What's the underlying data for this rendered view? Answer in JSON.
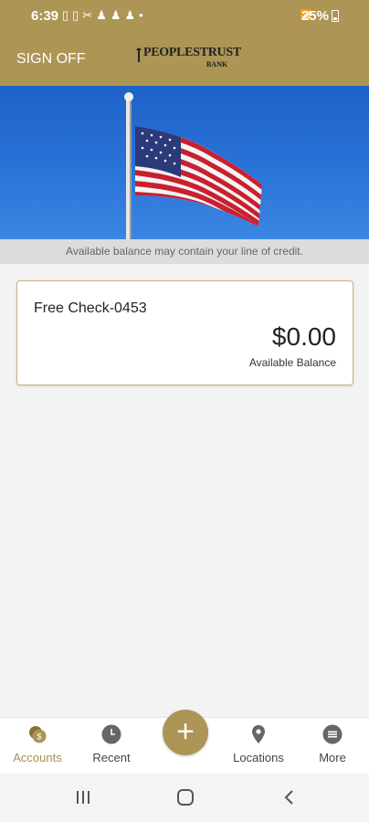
{
  "status_bar": {
    "time": "6:39",
    "battery": "25%",
    "left_icons": [
      "phone-icon",
      "phone-icon",
      "scissors-icon",
      "figure-icon",
      "figure-icon",
      "figure-icon",
      "dot-icon"
    ],
    "right_icons": [
      "wifi-icon",
      "volte-icon",
      "signal-icon",
      "battery-icon"
    ]
  },
  "header": {
    "sign_off": "SIGN OFF",
    "logo_main": "PEOPLESTRUST",
    "logo_sub": "BANK"
  },
  "notice": "Available balance may contain your line of credit.",
  "accounts": [
    {
      "name": "Free Check-0453",
      "balance": "$0.00",
      "balance_label": "Available Balance"
    }
  ],
  "bottom_nav": {
    "items": [
      {
        "label": "Accounts",
        "icon": "accounts-coin-icon",
        "active": true
      },
      {
        "label": "Recent",
        "icon": "clock-icon",
        "active": false
      },
      {
        "label": "Locations",
        "icon": "location-pin-icon",
        "active": false
      },
      {
        "label": "More",
        "icon": "menu-circle-icon",
        "active": false
      }
    ],
    "add_label": "+"
  },
  "colors": {
    "brand_gold": "#ac9555",
    "active_label": "#a88f4e",
    "sky_blue": "#2a73d8"
  }
}
